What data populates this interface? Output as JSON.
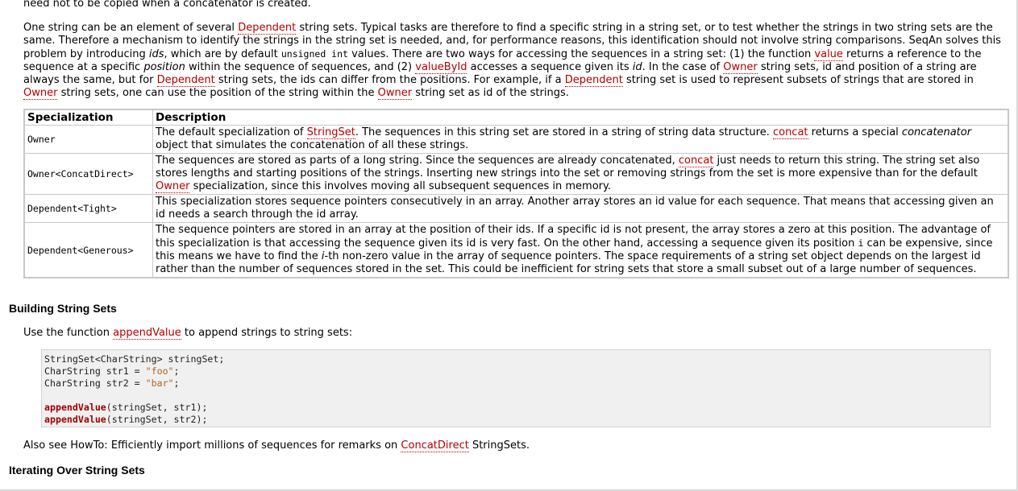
{
  "intro_cut": "need not to be copied when a concatenator is created.",
  "intro": {
    "s1": "One string can be an element of several ",
    "dependent": "Dependent",
    "s2": " string sets. Typical tasks are therefore to find a specific string in a string set, or to test whether the strings in two string sets are the same. Therefore a mechanism to identify the strings in the string set is needed, and, for performance reasons, this identification should not involve string comparisons. SeqAn solves this problem by introducing ",
    "ids": "ids",
    "s3": ", which are by default ",
    "unsigned_int": "unsigned int",
    "s4": " values. There are two ways for accessing the sequences in a string set: (1) the function ",
    "value": "value",
    "s5": " returns a reference to the sequence at a specific ",
    "position": "position",
    "s6": " within the sequence of sequences, and (2) ",
    "value_by_id": "valueById",
    "s7": " accesses a sequence given its ",
    "id": "id",
    "s8": ". In the case of ",
    "owner": "Owner",
    "s9": " string sets, id and position of a string are always the same, but for ",
    "s10": " string sets, the ids can differ from the positions. For example, if a ",
    "s11": " string set is used to represent subsets of strings that are stored in ",
    "s12": " string sets, one can use the position of the string within the ",
    "s13": " string set as id of the strings."
  },
  "table": {
    "headers": [
      "Specialization",
      "Description"
    ],
    "rows": [
      {
        "key": "Owner",
        "d1": "The default specialization of ",
        "link1": "StringSet",
        "d2": ". The sequences in this string set are stored in a string of string data structure. ",
        "link2": "concat",
        "d3": " returns a special ",
        "em": "concatenator",
        "d4": " object that simulates the concatenation of all these strings."
      },
      {
        "key": "Owner<ConcatDirect>",
        "d1": "The sequences are stored as parts of a long string. Since the sequences are already concatenated, ",
        "link1": "concat",
        "d2": " just needs to return this string. The string set also stores lengths and starting positions of the strings. Inserting new strings into the set or removing strings from the set is more expensive than for the default ",
        "link2": "Owner",
        "d3": " specialization, since this involves moving all subsequent sequences in memory."
      },
      {
        "key": "Dependent<Tight>",
        "d1": "This specialization stores sequence pointers consecutively in an array. Another array stores an id value for each sequence. That means that accessing given an id needs a search through the id array."
      },
      {
        "key": "Dependent<Generous>",
        "d1": "The sequence pointers are stored in an array at the position of their ids. If a specific id is not present, the array stores a zero at this position. The advantage of this specialization is that accessing the sequence given its id is very fast. On the other hand, accessing a sequence given its position ",
        "code": "i",
        "d2": " can be expensive, since this means we have to find the ",
        "em": "i",
        "d3": "-th non-zero value in the array of sequence pointers. The space requirements of a string set object depends on the largest id rather than the number of sequences stored in the set. This could be inefficient for string sets that store a small subset out of a large number of sequences."
      }
    ]
  },
  "building": {
    "heading": "Building String Sets",
    "use_pre": "Use the function ",
    "use_link": "appendValue",
    "use_post": " to append strings to string sets:",
    "code": {
      "l1": "StringSet<CharString> stringSet;",
      "l2a": "CharString str1 = ",
      "l2s": "\"foo\"",
      "l2b": ";",
      "l3a": "CharString str2 = ",
      "l3s": "\"bar\"",
      "l3b": ";",
      "l5k": "appendValue",
      "l5r": "(stringSet, str1);",
      "l6k": "appendValue",
      "l6r": "(stringSet, str2);"
    },
    "also_pre": "Also see HowTo: Efficiently import millions of sequences for remarks on ",
    "also_link": "ConcatDirect",
    "also_post": " StringSets."
  },
  "iterating": {
    "heading": "Iterating Over String Sets"
  }
}
